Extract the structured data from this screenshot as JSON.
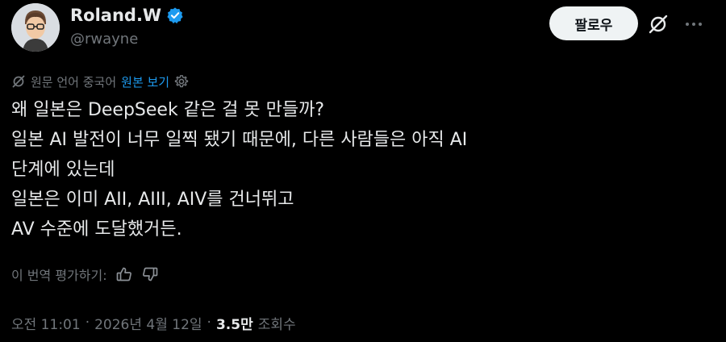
{
  "profile": {
    "display_name": "Roland.W",
    "handle": "@rwayne",
    "verified": true,
    "verified_color": "#1d9bf0"
  },
  "actions": {
    "follow_label": "팔로우",
    "grok_icon": "slashed-circle-icon",
    "more_icon": "more-horizontal-icon"
  },
  "translation": {
    "icon": "translate-icon",
    "prefix": "원문 언어 중국어",
    "show_original": "원본 보기",
    "settings_icon": "gear-icon"
  },
  "tweet": {
    "lines": [
      "왜 일본은 DeepSeek 같은 걸 못 만들까?",
      "일본 AI 발전이 너무 일찍 됐기 때문에, 다른 사람들은 아직 AI",
      "단계에 있는데",
      "일본은 이미 AII, AIII, AIV를 건너뛰고",
      "AV 수준에 도달했거든."
    ]
  },
  "rating": {
    "label": "이 번역 평가하기:",
    "thumbs_up_icon": "thumbs-up-icon",
    "thumbs_down_icon": "thumbs-down-icon"
  },
  "meta": {
    "time": "오전 11:01",
    "separator": "·",
    "date": "2026년 4월 12일",
    "views_count": "3.5만",
    "views_label": "조회수"
  },
  "colors": {
    "background": "#000000",
    "text": "#e7e9ea",
    "muted": "#71767b",
    "accent": "#1d9bf0"
  }
}
